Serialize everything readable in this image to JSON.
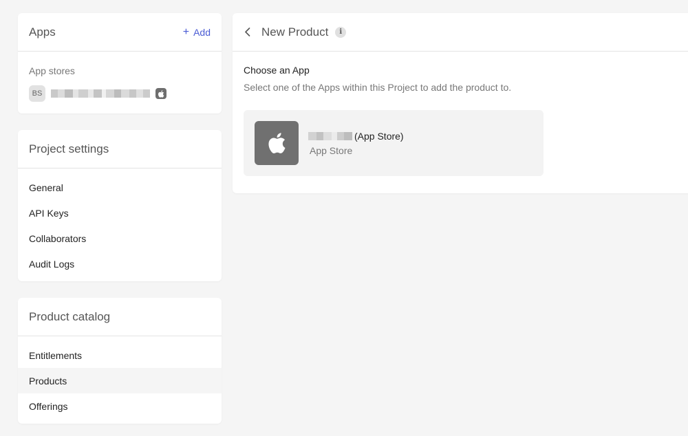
{
  "apps": {
    "title": "Apps",
    "add_label": "Add",
    "section_label": "App stores",
    "app_avatar": "BS",
    "app_icon": "apple-icon"
  },
  "project_settings": {
    "title": "Project settings",
    "items": [
      {
        "label": "General"
      },
      {
        "label": "API Keys"
      },
      {
        "label": "Collaborators"
      },
      {
        "label": "Audit Logs"
      }
    ]
  },
  "product_catalog": {
    "title": "Product catalog",
    "items": [
      {
        "label": "Entitlements"
      },
      {
        "label": "Products",
        "active": true
      },
      {
        "label": "Offerings"
      }
    ]
  },
  "main": {
    "title": "New Product",
    "info_icon": "i",
    "choose_title": "Choose an App",
    "choose_subtitle": "Select one of the Apps within this Project to add the product to.",
    "app_option": {
      "name_suffix": "(App Store)",
      "store": "App Store",
      "icon": "apple-icon"
    }
  },
  "colors": {
    "accent": "#4a5bd4",
    "background": "#f5f5f5",
    "icon_bg": "#707070"
  }
}
